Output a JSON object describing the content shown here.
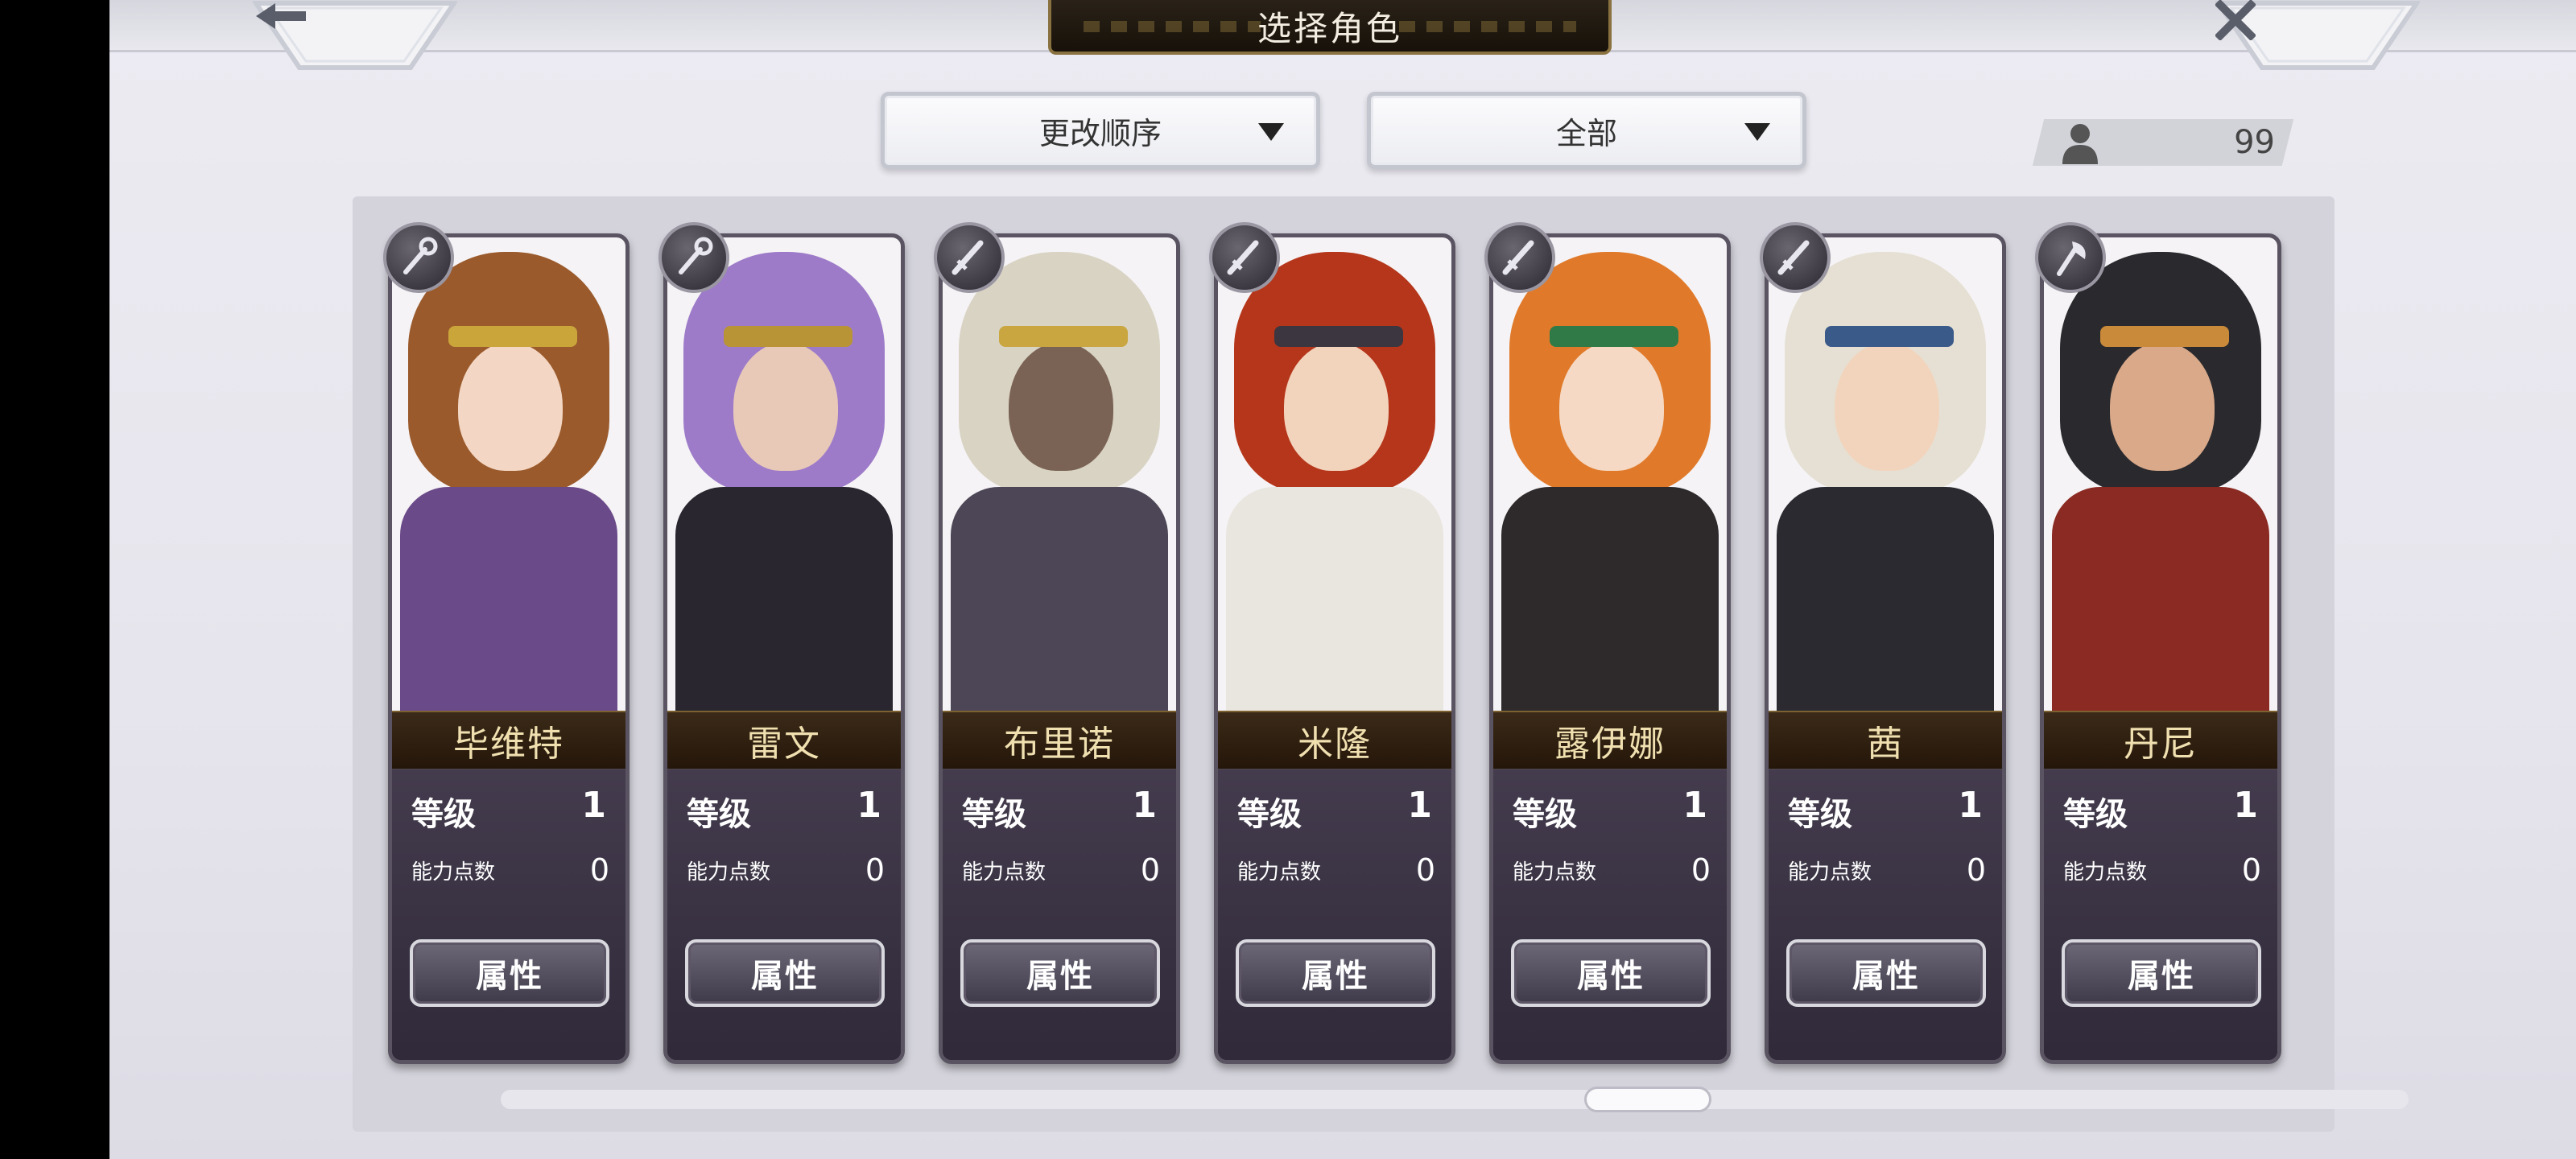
{
  "header": {
    "title": "选择角色"
  },
  "nav": {
    "back_icon": "arrow-left-icon",
    "close_icon": "close-icon"
  },
  "filters": {
    "sort_label": "更改顺序",
    "category_label": "全部"
  },
  "roster": {
    "count": "99",
    "icon": "person-icon"
  },
  "labels": {
    "level": "等级",
    "ability_points": "能力点数",
    "attributes": "属性"
  },
  "characters": [
    {
      "name": "毕维特",
      "level": "1",
      "ability_points": "0",
      "weapon_icon": "staff-icon",
      "hair": "#9a5a2c",
      "skin": "#f3d7c4",
      "outfit": "#6b4a8a",
      "accent": "#c9a53a"
    },
    {
      "name": "雷文",
      "level": "1",
      "ability_points": "0",
      "weapon_icon": "staff-icon",
      "hair": "#9d7bc9",
      "skin": "#e8c9b8",
      "outfit": "#2a2630",
      "accent": "#b89436"
    },
    {
      "name": "布里诺",
      "level": "1",
      "ability_points": "0",
      "weapon_icon": "sword-icon",
      "hair": "#d9d3c4",
      "skin": "#7a6354",
      "outfit": "#4c4656",
      "accent": "#c9a640"
    },
    {
      "name": "米隆",
      "level": "1",
      "ability_points": "0",
      "weapon_icon": "sword-icon",
      "hair": "#b5361a",
      "skin": "#f2d3bc",
      "outfit": "#e9e6e0",
      "accent": "#3b3640"
    },
    {
      "name": "露伊娜",
      "level": "1",
      "ability_points": "0",
      "weapon_icon": "sword-icon",
      "hair": "#e07a2a",
      "skin": "#f5d9c4",
      "outfit": "#2e2a2c",
      "accent": "#2f7a46"
    },
    {
      "name": "茜",
      "level": "1",
      "ability_points": "0",
      "weapon_icon": "sword-icon",
      "hair": "#e5e0d3",
      "skin": "#f2d4bd",
      "outfit": "#2a2a30",
      "accent": "#3a5a8a"
    },
    {
      "name": "丹尼",
      "level": "1",
      "ability_points": "0",
      "weapon_icon": "axe-icon",
      "hair": "#2a2a2e",
      "skin": "#d9a98a",
      "outfit": "#8a2a22",
      "accent": "#c98a3a"
    }
  ]
}
